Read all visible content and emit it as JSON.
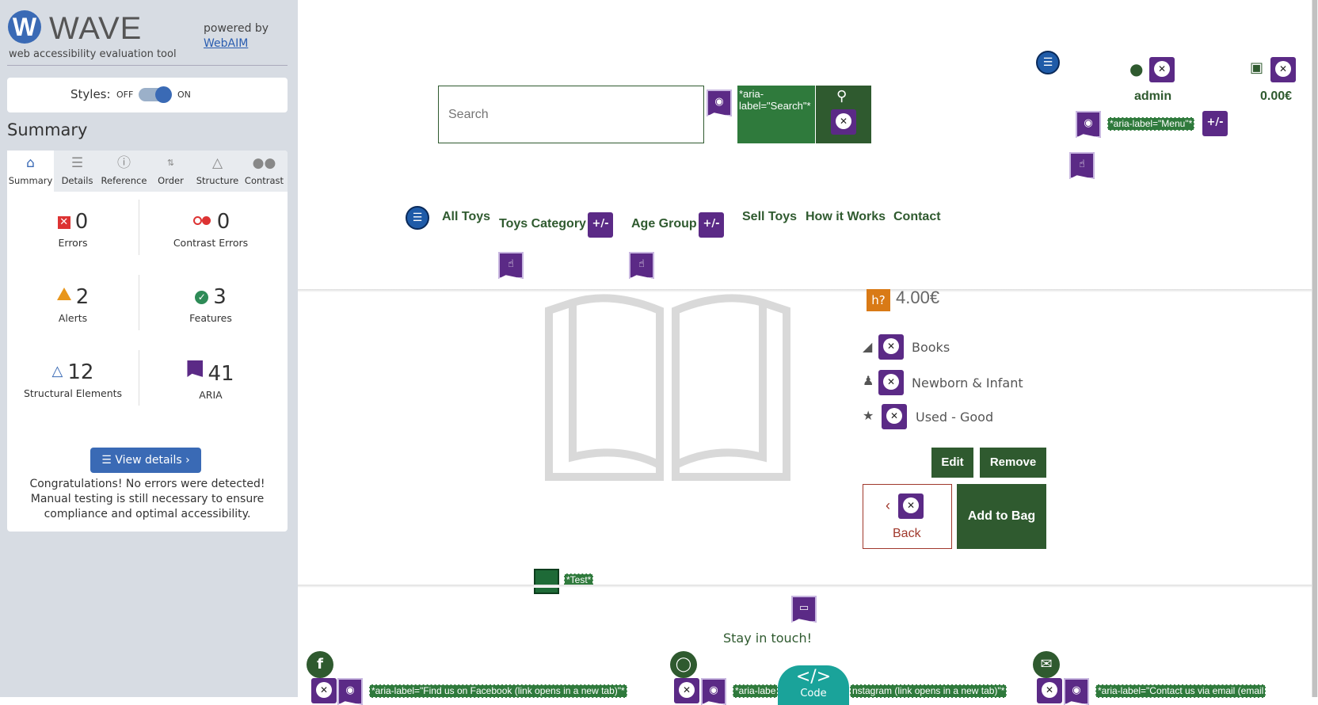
{
  "wave": {
    "logo_letter": "W",
    "title": "WAVE",
    "subtitle": "web accessibility evaluation tool",
    "powered_by": "powered by",
    "webaim": "WebAIM",
    "styles_label": "Styles:",
    "off": "OFF",
    "on": "ON",
    "summary_heading": "Summary",
    "tabs": [
      {
        "label": "Summary",
        "icon": "home-icon"
      },
      {
        "label": "Details",
        "icon": "list-icon"
      },
      {
        "label": "Reference",
        "icon": "info-icon"
      },
      {
        "label": "Order",
        "icon": "order-icon"
      },
      {
        "label": "Structure",
        "icon": "structure-icon"
      },
      {
        "label": "Contrast",
        "icon": "contrast-icon"
      }
    ],
    "stats": {
      "errors": {
        "value": "0",
        "label": "Errors"
      },
      "contrast": {
        "value": "0",
        "label": "Contrast Errors"
      },
      "alerts": {
        "value": "2",
        "label": "Alerts"
      },
      "features": {
        "value": "3",
        "label": "Features"
      },
      "structural": {
        "value": "12",
        "label": "Structural Elements"
      },
      "aria": {
        "value": "41",
        "label": "ARIA"
      }
    },
    "view_details": "View details ›",
    "congrats": "Congratulations! No errors were detected! Manual testing is still necessary to ensure compliance and optimal accessibility.",
    "accent": "#3a6ab5"
  },
  "site": {
    "search_placeholder": "Search",
    "search_aria": "*aria-label=\"Search\"*",
    "menu_aria": "*aria-label=\"Menu\"*",
    "plus_minus": "+/-",
    "admin": "admin",
    "cart": "0.00€",
    "nav": [
      "All Toys",
      "Toys Category",
      "Age Group",
      "Sell Toys",
      "How it Works",
      "Contact"
    ],
    "price": "4.00€",
    "help_icon": "h?",
    "meta": [
      "Books",
      "Newborn & Infant",
      "Used - Good"
    ],
    "edit": "Edit",
    "remove": "Remove",
    "back": "Back",
    "add_to_bag": "Add to Bag",
    "test_tag": "*Test*",
    "stay": "Stay in touch!",
    "facebook_aria": "*aria-label=\"Find us on Facebook (link opens in a new tab)\"*",
    "instagram_aria_left": "*aria-labe",
    "instagram_aria_right": "nstagram (link opens in a new tab)\"*",
    "email_aria": "*aria-label=\"Contact us via email (email",
    "code": "Code",
    "brand_green": "#2f5a2f"
  }
}
